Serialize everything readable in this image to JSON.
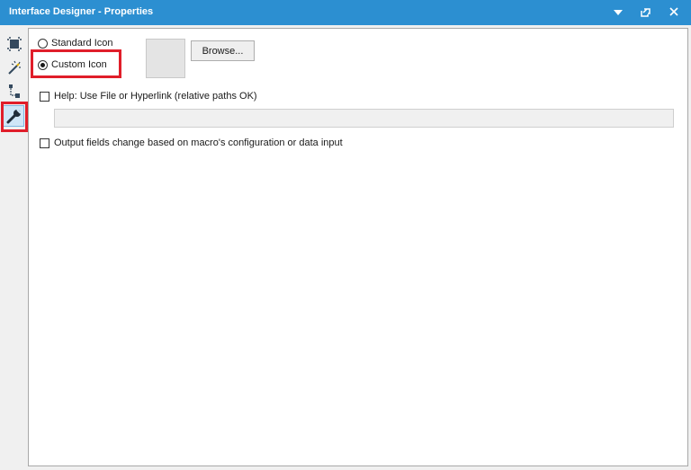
{
  "window": {
    "title": "Interface Designer - Properties"
  },
  "title_buttons": {
    "dropdown_icon": "chevron-down-icon",
    "restore_icon": "restore-window-icon",
    "close_icon": "close-icon"
  },
  "toolbar": {
    "items": [
      {
        "icon": "layout-frame-icon"
      },
      {
        "icon": "magic-wand-icon"
      },
      {
        "icon": "tree-view-icon"
      },
      {
        "icon": "wrench-icon",
        "selected": true
      }
    ]
  },
  "icon_options": {
    "standard_label": "Standard Icon",
    "custom_label": "Custom Icon",
    "selected": "custom"
  },
  "browse_label": "Browse...",
  "help": {
    "label": "Help: Use File or Hyperlink (relative paths OK)",
    "checked": false,
    "value": ""
  },
  "output": {
    "label": "Output fields change based on macro's configuration or data input",
    "checked": false
  },
  "colors": {
    "title_bar": "#2c8fd1",
    "highlight": "#e01e2a"
  }
}
